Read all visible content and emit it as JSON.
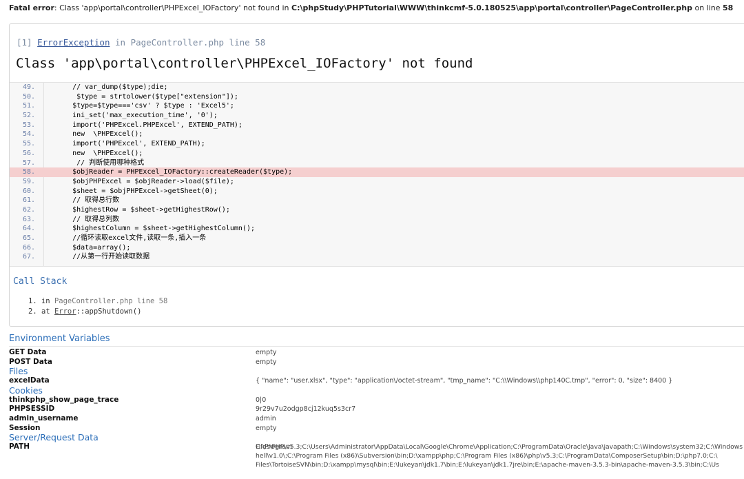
{
  "fatal": {
    "label": "Fatal error",
    "message": ": Class 'app\\portal\\controller\\PHPExcel_IOFactory' not found in ",
    "file": "C:\\phpStudy\\PHPTutorial\\WWW\\thinkcmf-5.0.180525\\app\\portal\\controller\\PageController.php",
    "line_text": " on line ",
    "line": "58"
  },
  "exception": {
    "index": "[1]",
    "type": "ErrorException",
    "in_text": " in PageController.php line 58",
    "title": "Class 'app\\portal\\controller\\PHPExcel_IOFactory' not found"
  },
  "code": [
    {
      "n": "49.",
      "code": "    // var_dump($type);die;"
    },
    {
      "n": "50.",
      "code": "     $type = strtolower($type[\"extension\"]);"
    },
    {
      "n": "51.",
      "code": "    $type=$type==='csv' ? $type : 'Excel5';"
    },
    {
      "n": "52.",
      "code": "    ini_set('max_execution_time', '0');"
    },
    {
      "n": "53.",
      "code": "    import('PHPExcel.PHPExcel', EXTEND_PATH);"
    },
    {
      "n": "54.",
      "code": "    new  \\PHPExcel();"
    },
    {
      "n": "55.",
      "code": "    import('PHPExcel', EXTEND_PATH);"
    },
    {
      "n": "56.",
      "code": "    new  \\PHPExcel();"
    },
    {
      "n": "57.",
      "code": "     // 判断使用哪种格式"
    },
    {
      "n": "58.",
      "code": "    $objReader = PHPExcel_IOFactory::createReader($type);"
    },
    {
      "n": "59.",
      "code": "    $objPHPExcel = $objReader->load($file);"
    },
    {
      "n": "60.",
      "code": "    $sheet = $objPHPExcel->getSheet(0);"
    },
    {
      "n": "61.",
      "code": "    // 取得总行数"
    },
    {
      "n": "62.",
      "code": "    $highestRow = $sheet->getHighestRow();"
    },
    {
      "n": "63.",
      "code": "    // 取得总列数"
    },
    {
      "n": "64.",
      "code": "    $highestColumn = $sheet->getHighestColumn();"
    },
    {
      "n": "65.",
      "code": "    //循环读取excel文件,读取一条,插入一条"
    },
    {
      "n": "66.",
      "code": "    $data=array();"
    },
    {
      "n": "67.",
      "code": "    //从第一行开始读取数据"
    }
  ],
  "highlight_line": "58.",
  "callstack": {
    "title": "Call Stack",
    "items": [
      {
        "n": "1.",
        "prefix": "in ",
        "text": "PageController.php line 58"
      },
      {
        "n": "2.",
        "prefix": "at ",
        "class": "Error",
        "text": "::appShutdown()"
      }
    ]
  },
  "env": {
    "title": "Environment Variables",
    "rows": [
      {
        "k": "GET Data",
        "v": "empty"
      },
      {
        "k": "POST Data",
        "v": "empty"
      },
      {
        "section": "Files"
      },
      {
        "k": "excelData",
        "v": "{ \"name\": \"user.xlsx\", \"type\": \"application\\/octet-stream\", \"tmp_name\": \"C:\\\\Windows\\\\php140C.tmp\", \"error\": 0, \"size\": 8400 }"
      },
      {
        "section": "Cookies"
      },
      {
        "k": "thinkphp_show_page_trace",
        "v": "0|0"
      },
      {
        "k": "PHPSESSID",
        "v": "9r29v7u2odgp8cj12kuq5s3cr7"
      },
      {
        "k": "admin_username",
        "v": "admin"
      },
      {
        "k": "Session",
        "v": "empty"
      },
      {
        "section": "Server/Request Data"
      },
      {
        "k": "PATH",
        "v": "C:\\Program"
      }
    ],
    "path_lines": [
      "Files\\PHP\\v5.3;C:\\Users\\Administrator\\AppData\\Local\\Google\\Chrome\\Application;C:\\ProgramData\\Oracle\\Java\\javapath;C:\\Windows\\system32;C:\\Windows",
      "hell\\v1.0\\;C:\\Program Files (x86)\\Subversion\\bin;D:\\xampp\\php;C:\\Program Files (x86)\\php\\v5.3;C:\\ProgramData\\ComposerSetup\\bin;D:\\php7.0;C:\\",
      "Files\\TortoiseSVN\\bin;D:\\xampp\\mysql\\bin;E:\\lukeyan\\jdk1.7\\bin;E:\\lukeyan\\jdk1.7jre\\bin;E:\\apache-maven-3.5.3-bin\\apache-maven-3.5.3\\bin;C:\\Us"
    ]
  },
  "colors": {
    "highlight": "#f5cfcf",
    "link": "#2a6db8",
    "code_bg": "#f7f7f7"
  }
}
